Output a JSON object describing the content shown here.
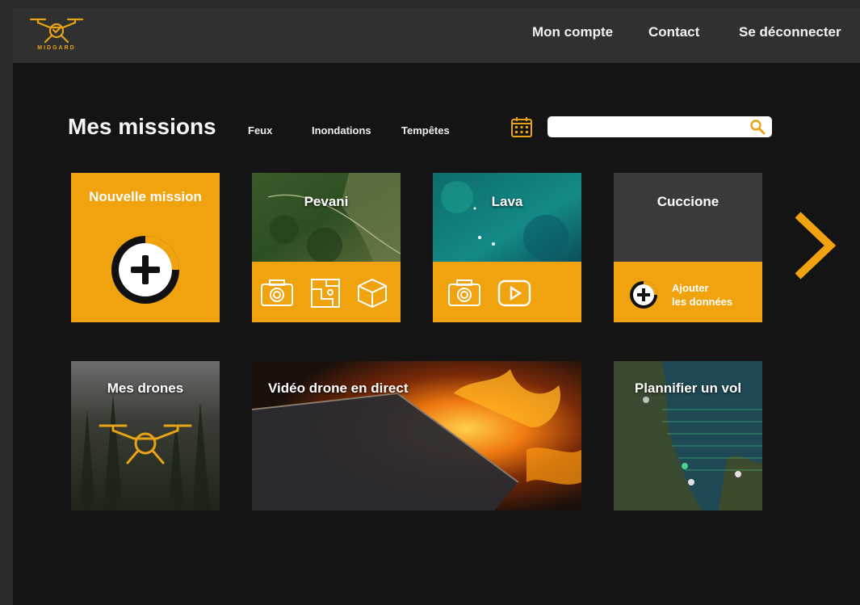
{
  "brand": {
    "name": "MIDGARD"
  },
  "nav": {
    "account": "Mon compte",
    "contact": "Contact",
    "logout": "Se déconnecter"
  },
  "page": {
    "title": "Mes missions"
  },
  "filters": [
    "Feux",
    "Inondations",
    "Tempêtes"
  ],
  "search": {
    "placeholder": ""
  },
  "cards": {
    "new_mission": "Nouvelle mission",
    "pevani": "Pevani",
    "lava": "Lava",
    "cuccione": "Cuccione",
    "add_data_line1": "Ajouter",
    "add_data_line2": "les données"
  },
  "tiles": {
    "drones": "Mes drones",
    "live_video": "Vidéo drone en direct",
    "plan_flight": "Plannifier un vol"
  },
  "colors": {
    "accent": "#f0a30e",
    "background": "#141414",
    "topbar": "#303030"
  },
  "icons": [
    "calendar-icon",
    "search-icon",
    "plus-circle-icon",
    "camera-icon",
    "map-icon",
    "cube-icon",
    "play-icon",
    "chevron-right-icon",
    "drone-icon"
  ]
}
